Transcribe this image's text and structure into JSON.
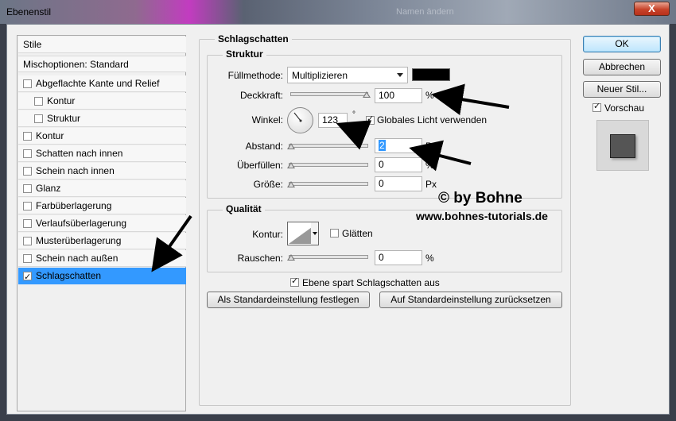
{
  "window": {
    "title": "Ebenenstil",
    "background_title": "Namen ändern",
    "close_label": "X"
  },
  "sidebar": {
    "header": "Stile",
    "blend": "Mischoptionen: Standard",
    "items": [
      {
        "label": "Abgeflachte Kante und Relief",
        "checked": false
      },
      {
        "label": "Kontur",
        "checked": false
      },
      {
        "label": "Struktur",
        "checked": false
      },
      {
        "label": "Kontur",
        "checked": false
      },
      {
        "label": "Schatten nach innen",
        "checked": false
      },
      {
        "label": "Schein nach innen",
        "checked": false
      },
      {
        "label": "Glanz",
        "checked": false
      },
      {
        "label": "Farbüberlagerung",
        "checked": false
      },
      {
        "label": "Verlaufsüberlagerung",
        "checked": false
      },
      {
        "label": "Musterüberlagerung",
        "checked": false
      },
      {
        "label": "Schein nach außen",
        "checked": false
      },
      {
        "label": "Schlagschatten",
        "checked": true
      }
    ]
  },
  "panel": {
    "title": "Schlagschatten",
    "struktur": {
      "title": "Struktur",
      "blend_label": "Füllmethode:",
      "blend_value": "Multiplizieren",
      "color": "#000000",
      "opacity_label": "Deckkraft:",
      "opacity_value": "100",
      "opacity_unit": "%",
      "angle_label": "Winkel:",
      "angle_value": "123",
      "angle_unit": "°",
      "global_light_label": "Globales Licht verwenden",
      "global_light_checked": true,
      "distance_label": "Abstand:",
      "distance_value": "2",
      "distance_unit": "Px",
      "spread_label": "Überfüllen:",
      "spread_value": "0",
      "spread_unit": "%",
      "size_label": "Größe:",
      "size_value": "0",
      "size_unit": "Px"
    },
    "qualitaet": {
      "title": "Qualität",
      "contour_label": "Kontur:",
      "antialias_label": "Glätten",
      "antialias_checked": false,
      "noise_label": "Rauschen:",
      "noise_value": "0",
      "noise_unit": "%"
    },
    "knockout_label": "Ebene spart Schlagschatten aus",
    "knockout_checked": true,
    "make_default": "Als Standardeinstellung festlegen",
    "reset_default": "Auf Standardeinstellung zurücksetzen"
  },
  "buttons": {
    "ok": "OK",
    "cancel": "Abbrechen",
    "new_style": "Neuer Stil...",
    "preview_label": "Vorschau",
    "preview_checked": true
  },
  "watermark": {
    "line1": "© by Bohne",
    "line2": "www.bohnes-tutorials.de"
  }
}
